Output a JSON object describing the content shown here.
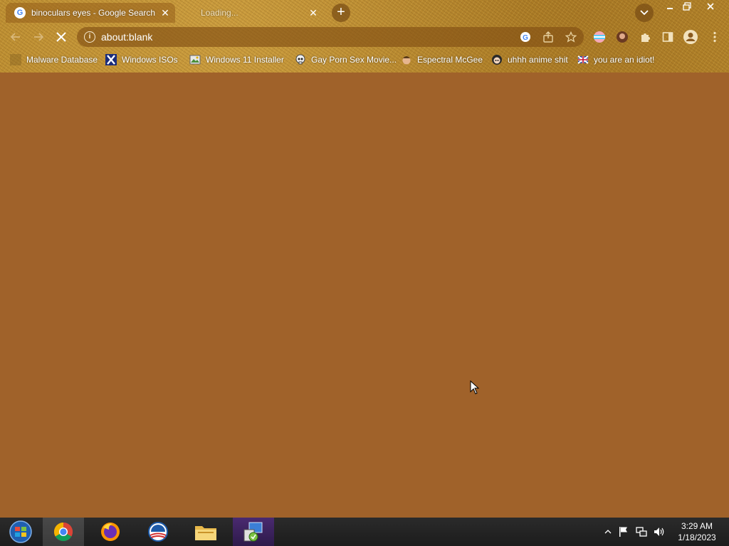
{
  "tabs": [
    {
      "title": "binoculars eyes - Google Search",
      "favicon": "google-icon",
      "active": true
    },
    {
      "title": "Loading...",
      "favicon": "none",
      "active": false
    }
  ],
  "toolbar": {
    "address": "about:blank"
  },
  "bookmarks": [
    {
      "label": "Malware Database",
      "icon": "bookmark-icon"
    },
    {
      "label": "Windows ISOs",
      "icon": "x-logo-icon"
    },
    {
      "label": "Windows 11 Installer",
      "icon": "image-icon"
    },
    {
      "label": "Gay Porn Sex Movie...",
      "icon": "skull-icon"
    },
    {
      "label": "Espectral McGee",
      "icon": "face-icon"
    },
    {
      "label": "uhhh anime shit",
      "icon": "anime-face-icon"
    },
    {
      "label": "you are an idiot!",
      "icon": "flag-icon"
    }
  ],
  "clock": {
    "time": "3:29 AM",
    "date": "1/18/2023"
  },
  "colors": {
    "page_background": "#a0622a",
    "chrome_texture": "#b98a2e",
    "taskbar": "#222222"
  }
}
